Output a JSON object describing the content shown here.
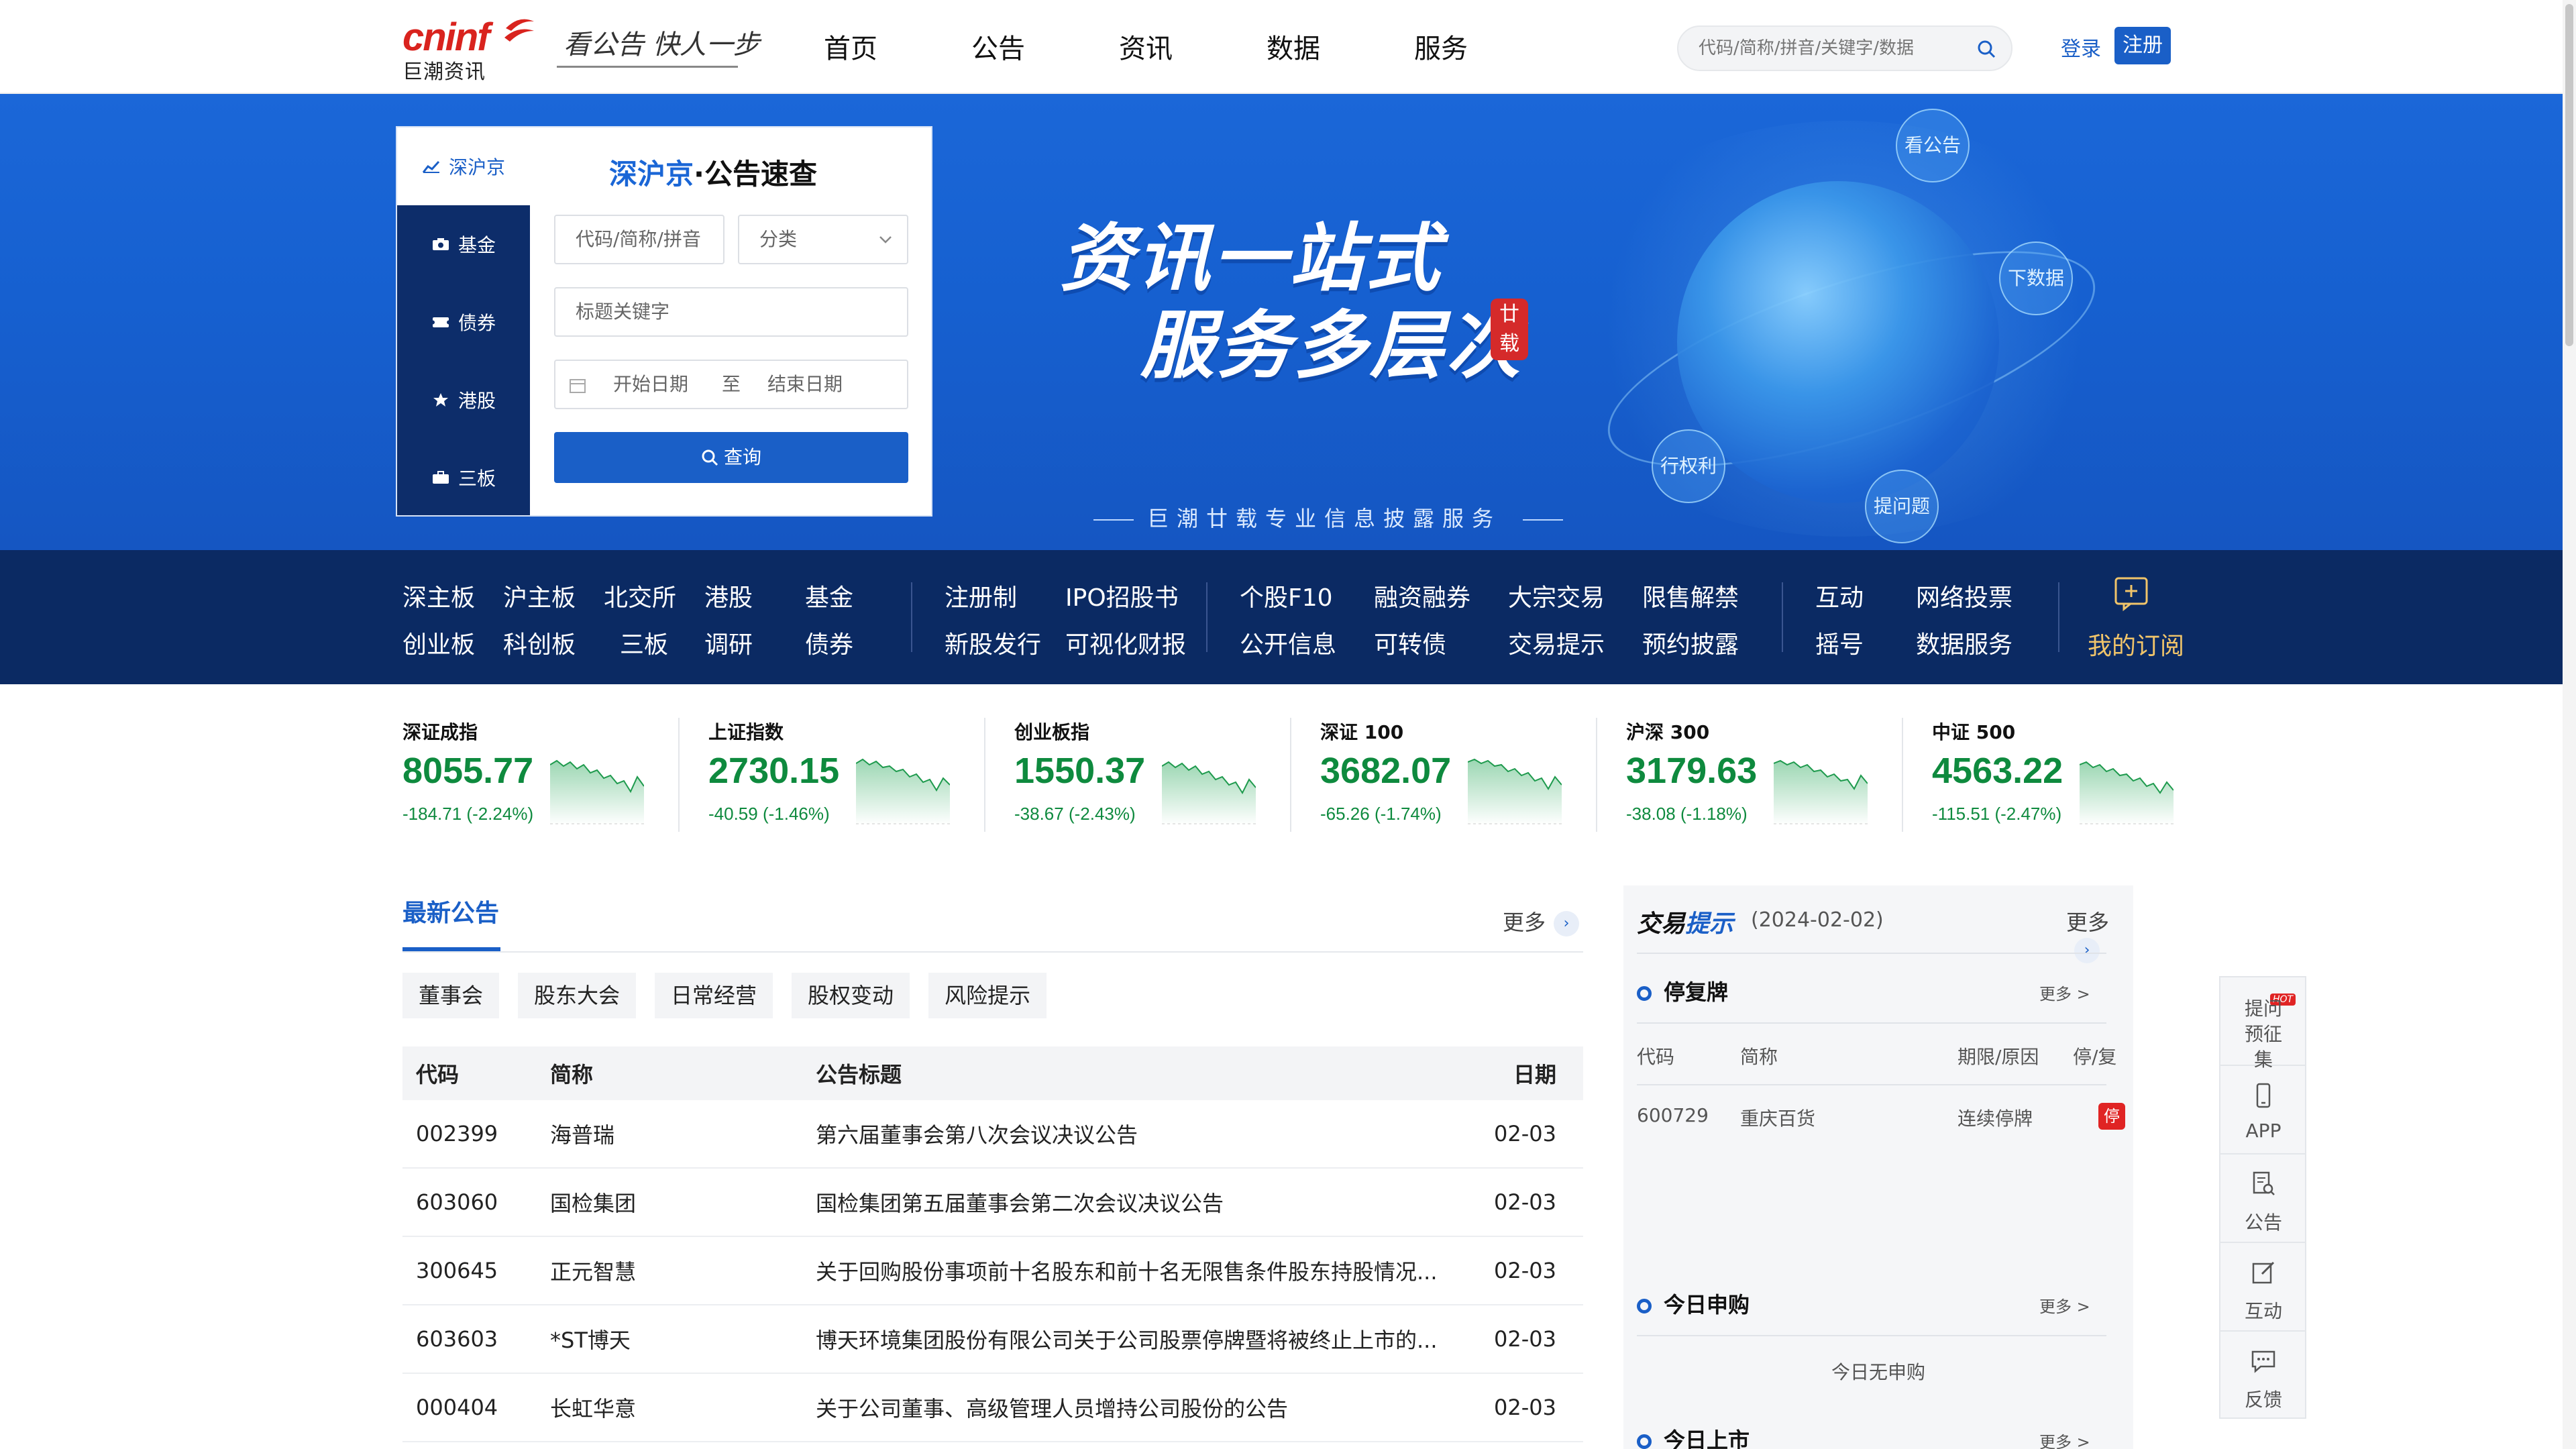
{
  "header": {
    "logo_text": "cninf",
    "logo_sub": "巨潮资讯",
    "slogan": "看公告 快人一步",
    "nav": [
      "首页",
      "公告",
      "资讯",
      "数据",
      "服务"
    ],
    "search_placeholder": "代码/简称/拼音/关键字/数据",
    "login": "登录",
    "register": "注册"
  },
  "banner": {
    "line1": "资讯一站式",
    "line2": "服务多层次",
    "seal": "廿载",
    "subtitle": "巨潮廿载专业信息披露服务",
    "bubbles": [
      "看公告",
      "下数据",
      "行权利",
      "提问题"
    ]
  },
  "query_panel": {
    "tabs": [
      {
        "label": "深沪京",
        "icon": "chart-icon"
      },
      {
        "label": "基金",
        "icon": "camera-icon"
      },
      {
        "label": "债券",
        "icon": "ticket-icon"
      },
      {
        "label": "港股",
        "icon": "star-icon"
      },
      {
        "label": "三板",
        "icon": "briefcase-icon"
      }
    ],
    "title_highlight": "深沪京",
    "title_rest": "·公告速查",
    "code_placeholder": "代码/简称/拼音",
    "category_placeholder": "分类",
    "keyword_placeholder": "标题关键字",
    "start_date": "开始日期",
    "to": "至",
    "end_date": "结束日期",
    "search_button": "查询"
  },
  "quick_nav": {
    "groups": [
      [
        "深主板",
        "沪主板",
        "北交所",
        "港股",
        "基金",
        "创业板",
        "科创板",
        "三板",
        "调研",
        "债券"
      ],
      [
        "注册制",
        "IPO招股书",
        "新股发行",
        "可视化财报"
      ],
      [
        "个股F10",
        "融资融券",
        "大宗交易",
        "限售解禁",
        "公开信息",
        "可转债",
        "交易提示",
        "预约披露"
      ],
      [
        "互动",
        "网络投票",
        "摇号",
        "数据服务"
      ]
    ],
    "subscription": "我的订阅"
  },
  "indices": [
    {
      "name": "深证成指",
      "value": "8055.77",
      "change": "-184.71 (-2.24%)"
    },
    {
      "name": "上证指数",
      "value": "2730.15",
      "change": "-40.59 (-1.46%)"
    },
    {
      "name": "创业板指",
      "value": "1550.37",
      "change": "-38.67 (-2.43%)"
    },
    {
      "name": "深证 100",
      "value": "3682.07",
      "change": "-65.26 (-1.74%)"
    },
    {
      "name": "沪深 300",
      "value": "3179.63",
      "change": "-38.08 (-1.18%)"
    },
    {
      "name": "中证 500",
      "value": "4563.22",
      "change": "-115.51 (-2.47%)"
    }
  ],
  "announcements": {
    "title": "最新公告",
    "more": "更多",
    "categories": [
      "董事会",
      "股东大会",
      "日常经营",
      "股权变动",
      "风险提示"
    ],
    "columns": [
      "代码",
      "简称",
      "公告标题",
      "日期"
    ],
    "rows": [
      [
        "002399",
        "海普瑞",
        "第六届董事会第八次会议决议公告",
        "02-03"
      ],
      [
        "603060",
        "国检集团",
        "国检集团第五届董事会第二次会议决议公告",
        "02-03"
      ],
      [
        "300645",
        "正元智慧",
        "关于回购股份事项前十名股东和前十名无限售条件股东持股情况...",
        "02-03"
      ],
      [
        "603603",
        "*ST博天",
        "博天环境集团股份有限公司关于公司股票停牌暨将被终止上市的...",
        "02-03"
      ],
      [
        "000404",
        "长虹华意",
        "关于公司董事、高级管理人员增持公司股份的公告",
        "02-03"
      ]
    ]
  },
  "trade_tips": {
    "title_a": "交易",
    "title_b": "提示",
    "date": "(2024-02-02)",
    "more": "更多",
    "suspension": {
      "title": "停复牌",
      "more": "更多 >",
      "columns": [
        "代码",
        "简称",
        "期限/原因",
        "停/复"
      ],
      "rows": [
        [
          "600729",
          "重庆百货",
          "连续停牌",
          "停"
        ]
      ]
    },
    "subscribe": {
      "title": "今日申购",
      "more": "更多 >",
      "empty": "今日无申购"
    },
    "listing": {
      "title": "今日上市",
      "more": "更多 >"
    }
  },
  "side_tools": [
    {
      "label": "提问预征集",
      "badge": "HOT",
      "icon": "question-icon"
    },
    {
      "label": "APP",
      "icon": "phone-icon"
    },
    {
      "label": "公告",
      "icon": "document-search-icon"
    },
    {
      "label": "互动",
      "icon": "edit-icon"
    },
    {
      "label": "反馈",
      "icon": "chat-icon"
    }
  ],
  "colors": {
    "brand": "#1a5fc7",
    "navy": "#0b2a63",
    "down_green": "#0e8a3e",
    "logo_red": "#d9231e",
    "alert_red": "#e02424"
  }
}
